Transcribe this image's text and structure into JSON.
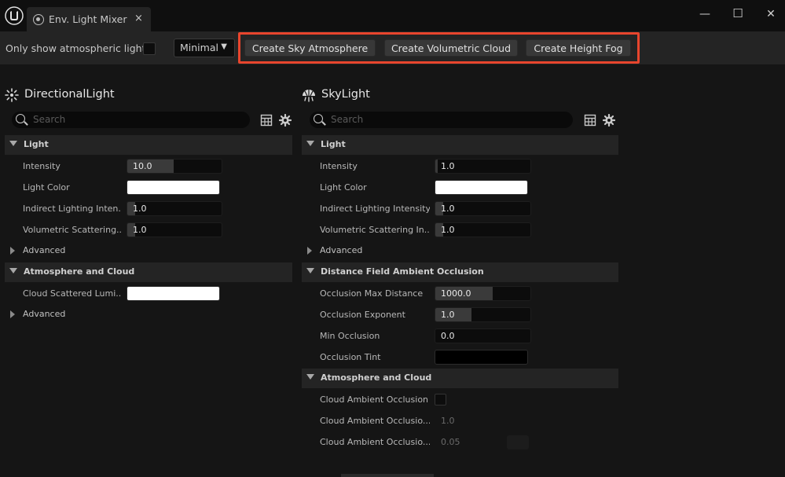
{
  "window": {
    "tab_title": "Env. Light Mixer",
    "tab_close": "×",
    "minimize": "—",
    "maximize": "☐",
    "close": "✕"
  },
  "toolbar": {
    "only_atmospheric_label": "Only show atmospheric lights",
    "only_atmospheric_checked": false,
    "mode_value": "Minimal",
    "create_sky_atmosphere": "Create Sky Atmosphere",
    "create_volumetric_cloud": "Create Volumetric Cloud",
    "create_height_fog": "Create Height Fog",
    "highlight_color": "#e8452d"
  },
  "directional": {
    "title": "DirectionalLight",
    "icon": "sun-icon",
    "search_placeholder": "Search",
    "light_section": "Light",
    "intensity_label": "Intensity",
    "intensity_value": "10.0",
    "light_color_label": "Light Color",
    "light_color": "#ffffff",
    "indirect_label": "Indirect Lighting Inten...",
    "indirect_value": "1.0",
    "volumetric_label": "Volumetric Scattering...",
    "volumetric_value": "1.0",
    "advanced_1": "Advanced",
    "atmos_section": "Atmosphere and Cloud",
    "cloud_scattered_label": "Cloud Scattered Lumi...",
    "cloud_scattered_color": "#ffffff",
    "advanced_2": "Advanced"
  },
  "sky": {
    "title": "SkyLight",
    "icon": "skylight-icon",
    "search_placeholder": "Search",
    "light_section": "Light",
    "intensity_label": "Intensity",
    "intensity_value": "1.0",
    "light_color_label": "Light Color",
    "light_color": "#ffffff",
    "indirect_label": "Indirect Lighting Intensity",
    "indirect_value": "1.0",
    "volumetric_label": "Volumetric Scattering In...",
    "volumetric_value": "1.0",
    "advanced_1": "Advanced",
    "dfao_section": "Distance Field Ambient Occlusion",
    "occ_max_label": "Occlusion Max Distance",
    "occ_max_value": "1000.0",
    "occ_exp_label": "Occlusion Exponent",
    "occ_exp_value": "1.0",
    "min_occ_label": "Min Occlusion",
    "min_occ_value": "0.0",
    "occ_tint_label": "Occlusion Tint",
    "occ_tint_color": "#000000",
    "atmos_section": "Atmosphere and Cloud",
    "cloud_ao_label": "Cloud Ambient Occlusion",
    "cloud_ao_checked": false,
    "cloud_ao_2_label": "Cloud Ambient Occlusio...",
    "cloud_ao_2_value": "1.0",
    "cloud_ao_3_label": "Cloud Ambient Occlusio...",
    "cloud_ao_3_value": "0.05"
  }
}
